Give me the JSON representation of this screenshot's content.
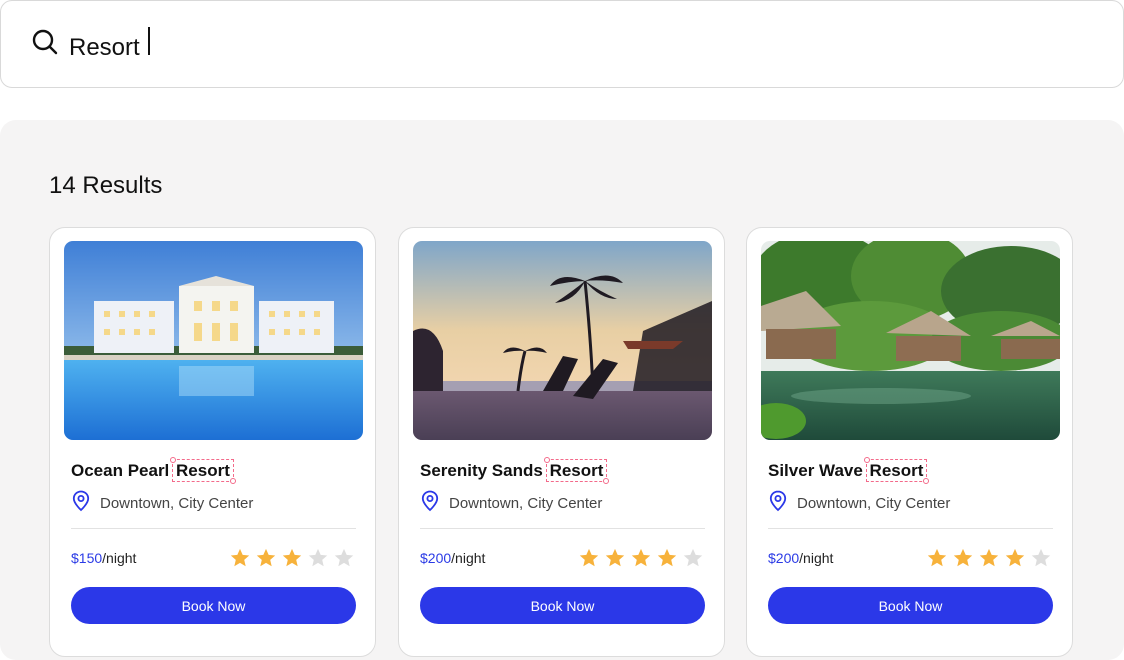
{
  "search": {
    "value": "Resort",
    "icon": "search-icon"
  },
  "results": {
    "count_label": "14 Results"
  },
  "colors": {
    "accent": "#2b38e8",
    "star_filled": "#f7b23b",
    "star_empty": "#dddddd",
    "highlight": "#f36a8a"
  },
  "cards": [
    {
      "name_prefix": "Ocean Pearl",
      "name_match": "Resort",
      "location": "Downtown, City Center",
      "price": "$150",
      "price_unit": "/night",
      "rating": 3,
      "max_rating": 5,
      "button_label": "Book Now",
      "image": "resort-pool-image"
    },
    {
      "name_prefix": "Serenity Sands",
      "name_match": "Resort",
      "location": "Downtown, City Center",
      "price": "$200",
      "price_unit": "/night",
      "rating": 4,
      "max_rating": 5,
      "button_label": "Book Now",
      "image": "beach-sunset-image"
    },
    {
      "name_prefix": "Silver Wave",
      "name_match": "Resort",
      "location": "Downtown, City Center",
      "price": "$200",
      "price_unit": "/night",
      "rating": 4,
      "max_rating": 5,
      "button_label": "Book Now",
      "image": "jungle-villa-image"
    }
  ]
}
